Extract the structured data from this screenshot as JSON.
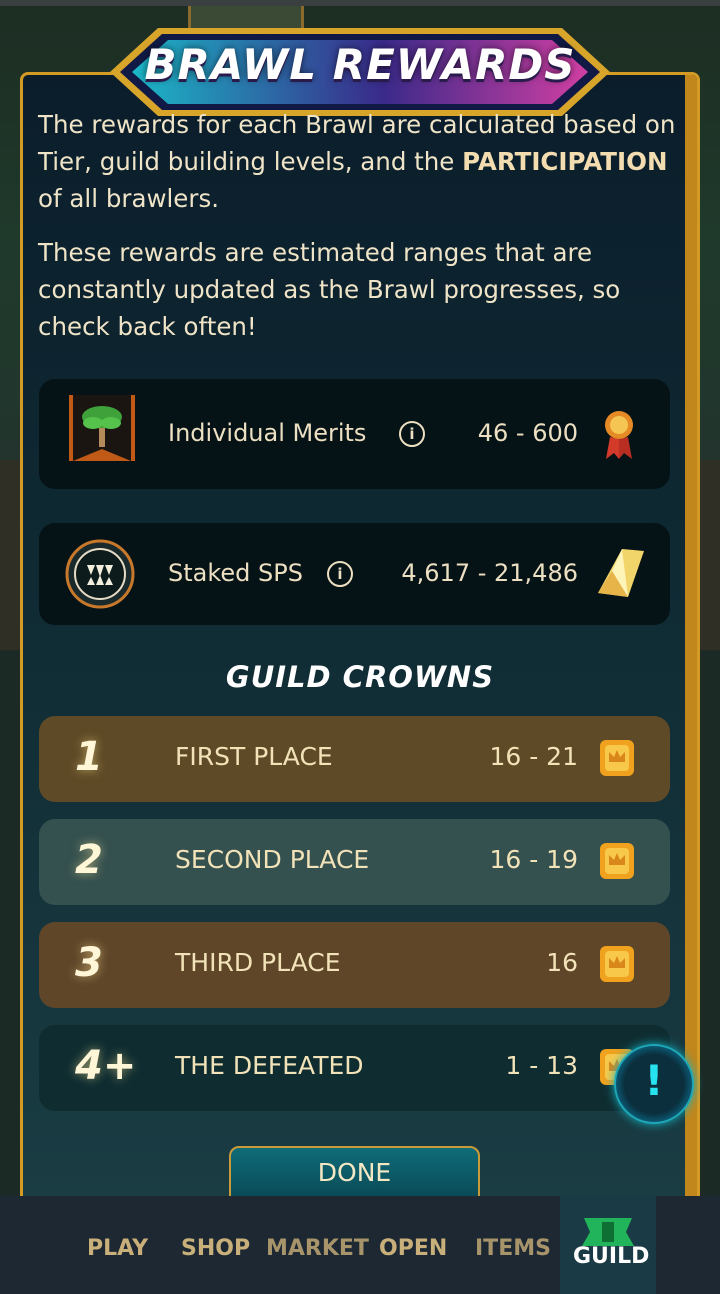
{
  "dialog": {
    "title": "BRAWL REWARDS",
    "intro_1_pre": "The rewards for each Brawl are calculated based on Tier, guild building levels, and the ",
    "intro_1_strong": "PARTICIPATION",
    "intro_1_post": " of all brawlers.",
    "intro_2": "These rewards are estimated ranges that are constantly updated as the Brawl progresses, so check back often!"
  },
  "rewards": [
    {
      "label": "Individual Merits",
      "value": "46 - 600",
      "icon": "tree-banner-icon",
      "reward_icon": "merit-medal-icon"
    },
    {
      "label": "Staked SPS",
      "value": "4,617 - 21,486",
      "icon": "fangs-icon",
      "reward_icon": "sps-crystal-icon"
    }
  ],
  "guild_crowns": {
    "title": "GUILD CROWNS",
    "rows": [
      {
        "rank": "1",
        "label": "FIRST PLACE",
        "value": "16 - 21",
        "color": "#5e4a26"
      },
      {
        "rank": "2",
        "label": "SECOND PLACE",
        "value": "16 - 19",
        "color": "#34504f"
      },
      {
        "rank": "3",
        "label": "THIRD PLACE",
        "value": "16",
        "color": "#5f4629"
      },
      {
        "rank": "4+",
        "label": "THE DEFEATED",
        "value": "1 - 13",
        "color": "#0f2d31"
      }
    ],
    "reward_icon": "crown-token-icon"
  },
  "done_label": "DONE",
  "fab_icon": "alert-exclamation-icon",
  "nav": {
    "items": [
      "PLAY",
      "SHOP",
      "MARKET",
      "OPEN",
      "ITEMS",
      "GUILD"
    ],
    "active": "GUILD"
  }
}
